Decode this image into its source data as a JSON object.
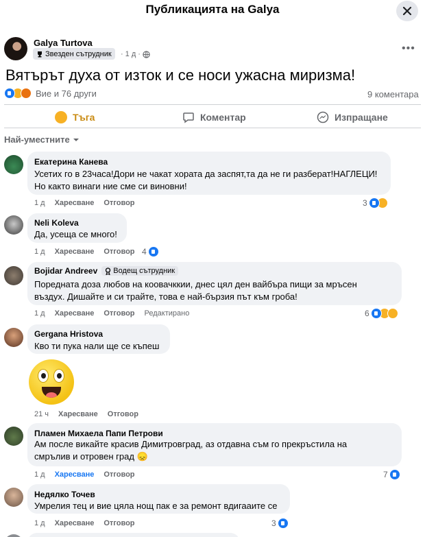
{
  "header": {
    "title": "Публикацията на Galya"
  },
  "post": {
    "author": "Galya Turtova",
    "badge": "Звезден сътрудник",
    "time": "1 д",
    "text": "Вятърът духа от изток и се носи ужасна миризма!",
    "reactions_summary": "Вие и 76 други",
    "comments_count": "9 коментара"
  },
  "actions": {
    "react_label": "Тъга",
    "comment_label": "Коментар",
    "share_label": "Изпращане"
  },
  "sort": {
    "label": "Най-уместните"
  },
  "comments": [
    {
      "name": "Екатерина Канева",
      "lines": [
        "Усетих го в 23часа!Дори не чакат хората да заспят,та да не ги разберат!НАГЛЕЦИ!",
        "Но както винаги ние сме си виновни!"
      ],
      "time": "1 д",
      "like": "Харесване",
      "reply": "Отговор",
      "reactions": "3"
    },
    {
      "name": "Neli Koleva",
      "lines": [
        "Да, усеща се много!"
      ],
      "time": "1 д",
      "like": "Харесване",
      "reply": "Отговор",
      "reactions": "4"
    },
    {
      "name": "Bojidar Andreev",
      "badge": "Водещ сътрудник",
      "lines": [
        "Поредната доза любов на коовачккии, днес цял ден вайбъра пищи за мръсен",
        "въздух. Дишайте и си трайте, това е най-бързия път към гроба!"
      ],
      "time": "1 д",
      "like": "Харесване",
      "reply": "Отговор",
      "edited": "Редактирано",
      "reactions": "6"
    },
    {
      "name": "Gergana Hristova",
      "lines": [
        "Кво ти пука нали ще се къпеш"
      ],
      "time": "21 ч",
      "like": "Харесване",
      "reply": "Отговор"
    },
    {
      "name": "Пламен Михаела Папи Петрови",
      "lines": [
        "Ам после викайте красив Димитровград, аз отдавна съм го прекръстила на",
        "смрълив и отровен град 😞"
      ],
      "time": "1 д",
      "like": "Харесване",
      "reply": "Отговор",
      "reactions": "7"
    },
    {
      "name": "Недялко Точев",
      "lines": [
        "Умрелия тец и вие цяла нощ пак е за ремонт вдигааите се"
      ],
      "time": "1 д",
      "like": "Харесване",
      "reply": "Отговор",
      "reactions": "3"
    }
  ]
}
